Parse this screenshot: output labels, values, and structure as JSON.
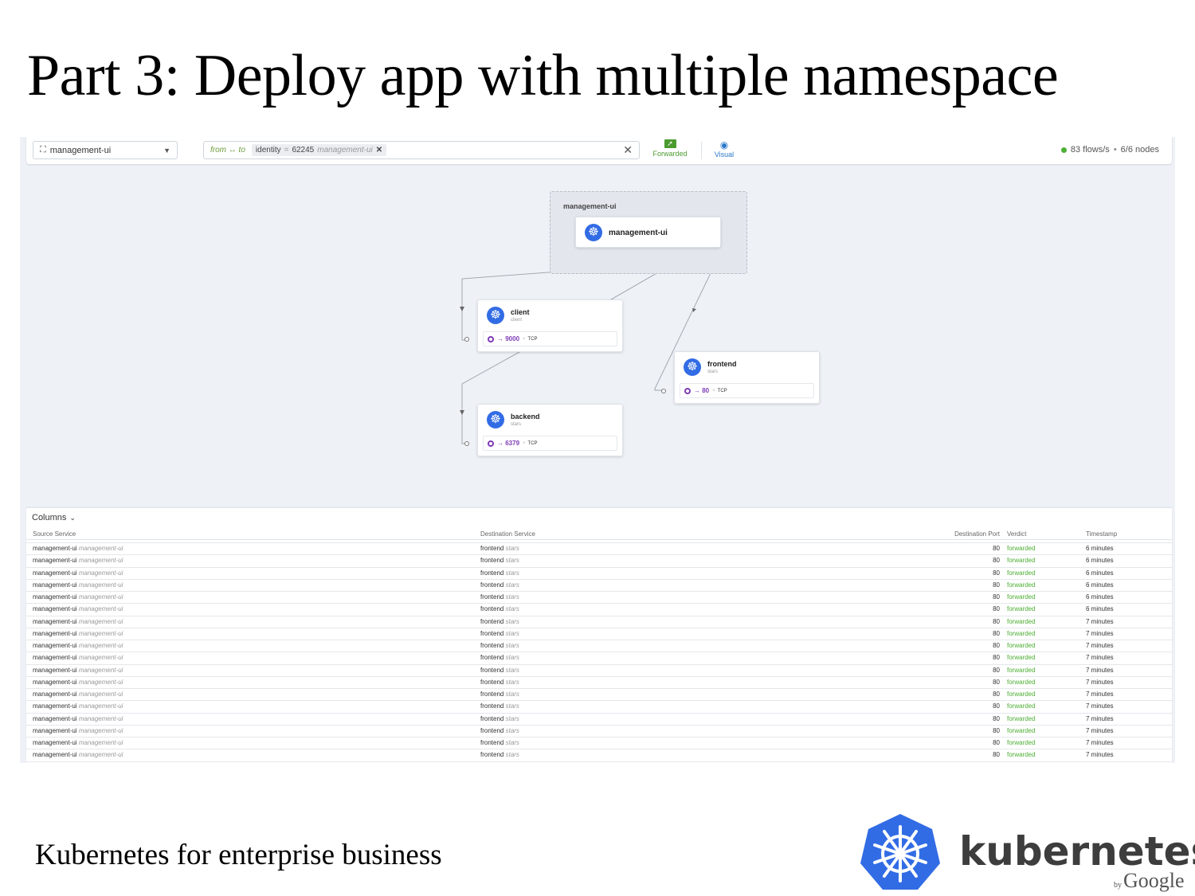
{
  "slide": {
    "title": "Part 3: Deploy app with multiple namespace",
    "footer": "Kubernetes for enterprise business"
  },
  "logo": {
    "wordmark": "kubernetes",
    "by": "by",
    "google": "Google",
    "icon": "kubernetes-helm-icon",
    "color": "#326ce5"
  },
  "toolbar": {
    "namespace": "management-ui",
    "filter": {
      "direction": "from ↔ to",
      "tag_key": "identity",
      "tag_eq": "=",
      "tag_value": "62245",
      "tag_label": "management-ui"
    },
    "forwarded_label": "Forwarded",
    "visual_label": "Visual",
    "flows": "83 flows/s",
    "nodes": "6/6 nodes"
  },
  "graph": {
    "namespace_box_label": "management-ui",
    "nodes": {
      "management_ui": {
        "title": "management-ui"
      },
      "client": {
        "title": "client",
        "namespace": "client",
        "port": "9000",
        "proto": "TCP"
      },
      "frontend": {
        "title": "frontend",
        "namespace": "stars",
        "port": "80",
        "proto": "TCP"
      },
      "backend": {
        "title": "backend",
        "namespace": "stars",
        "port": "6379",
        "proto": "TCP"
      }
    }
  },
  "table": {
    "columns_label": "Columns",
    "headers": {
      "source": "Source Service",
      "destination": "Destination Service",
      "port": "Destination Port",
      "verdict": "Verdict",
      "timestamp": "Timestamp"
    },
    "rows": [
      {
        "src": "management-ui",
        "src_ns": "management-ui",
        "dst": "frontend",
        "dst_ns": "stars",
        "port": "80",
        "verdict": "forwarded",
        "time": "6 minutes"
      },
      {
        "src": "management-ui",
        "src_ns": "management-ui",
        "dst": "frontend",
        "dst_ns": "stars",
        "port": "80",
        "verdict": "forwarded",
        "time": "6 minutes"
      },
      {
        "src": "management-ui",
        "src_ns": "management-ui",
        "dst": "frontend",
        "dst_ns": "stars",
        "port": "80",
        "verdict": "forwarded",
        "time": "6 minutes"
      },
      {
        "src": "management-ui",
        "src_ns": "management-ui",
        "dst": "frontend",
        "dst_ns": "stars",
        "port": "80",
        "verdict": "forwarded",
        "time": "6 minutes"
      },
      {
        "src": "management-ui",
        "src_ns": "management-ui",
        "dst": "frontend",
        "dst_ns": "stars",
        "port": "80",
        "verdict": "forwarded",
        "time": "6 minutes"
      },
      {
        "src": "management-ui",
        "src_ns": "management-ui",
        "dst": "frontend",
        "dst_ns": "stars",
        "port": "80",
        "verdict": "forwarded",
        "time": "6 minutes"
      },
      {
        "src": "management-ui",
        "src_ns": "management-ui",
        "dst": "frontend",
        "dst_ns": "stars",
        "port": "80",
        "verdict": "forwarded",
        "time": "7 minutes"
      },
      {
        "src": "management-ui",
        "src_ns": "management-ui",
        "dst": "frontend",
        "dst_ns": "stars",
        "port": "80",
        "verdict": "forwarded",
        "time": "7 minutes"
      },
      {
        "src": "management-ui",
        "src_ns": "management-ui",
        "dst": "frontend",
        "dst_ns": "stars",
        "port": "80",
        "verdict": "forwarded",
        "time": "7 minutes"
      },
      {
        "src": "management-ui",
        "src_ns": "management-ui",
        "dst": "frontend",
        "dst_ns": "stars",
        "port": "80",
        "verdict": "forwarded",
        "time": "7 minutes"
      },
      {
        "src": "management-ui",
        "src_ns": "management-ui",
        "dst": "frontend",
        "dst_ns": "stars",
        "port": "80",
        "verdict": "forwarded",
        "time": "7 minutes"
      },
      {
        "src": "management-ui",
        "src_ns": "management-ui",
        "dst": "frontend",
        "dst_ns": "stars",
        "port": "80",
        "verdict": "forwarded",
        "time": "7 minutes"
      },
      {
        "src": "management-ui",
        "src_ns": "management-ui",
        "dst": "frontend",
        "dst_ns": "stars",
        "port": "80",
        "verdict": "forwarded",
        "time": "7 minutes"
      },
      {
        "src": "management-ui",
        "src_ns": "management-ui",
        "dst": "frontend",
        "dst_ns": "stars",
        "port": "80",
        "verdict": "forwarded",
        "time": "7 minutes"
      },
      {
        "src": "management-ui",
        "src_ns": "management-ui",
        "dst": "frontend",
        "dst_ns": "stars",
        "port": "80",
        "verdict": "forwarded",
        "time": "7 minutes"
      },
      {
        "src": "management-ui",
        "src_ns": "management-ui",
        "dst": "frontend",
        "dst_ns": "stars",
        "port": "80",
        "verdict": "forwarded",
        "time": "7 minutes"
      },
      {
        "src": "management-ui",
        "src_ns": "management-ui",
        "dst": "frontend",
        "dst_ns": "stars",
        "port": "80",
        "verdict": "forwarded",
        "time": "7 minutes"
      },
      {
        "src": "management-ui",
        "src_ns": "management-ui",
        "dst": "frontend",
        "dst_ns": "stars",
        "port": "80",
        "verdict": "forwarded",
        "time": "7 minutes"
      }
    ]
  },
  "colors": {
    "verdict_forwarded": "#4caf33",
    "port": "#7d3cb5",
    "k8s_blue": "#326ce5",
    "visual": "#2a77c9"
  }
}
